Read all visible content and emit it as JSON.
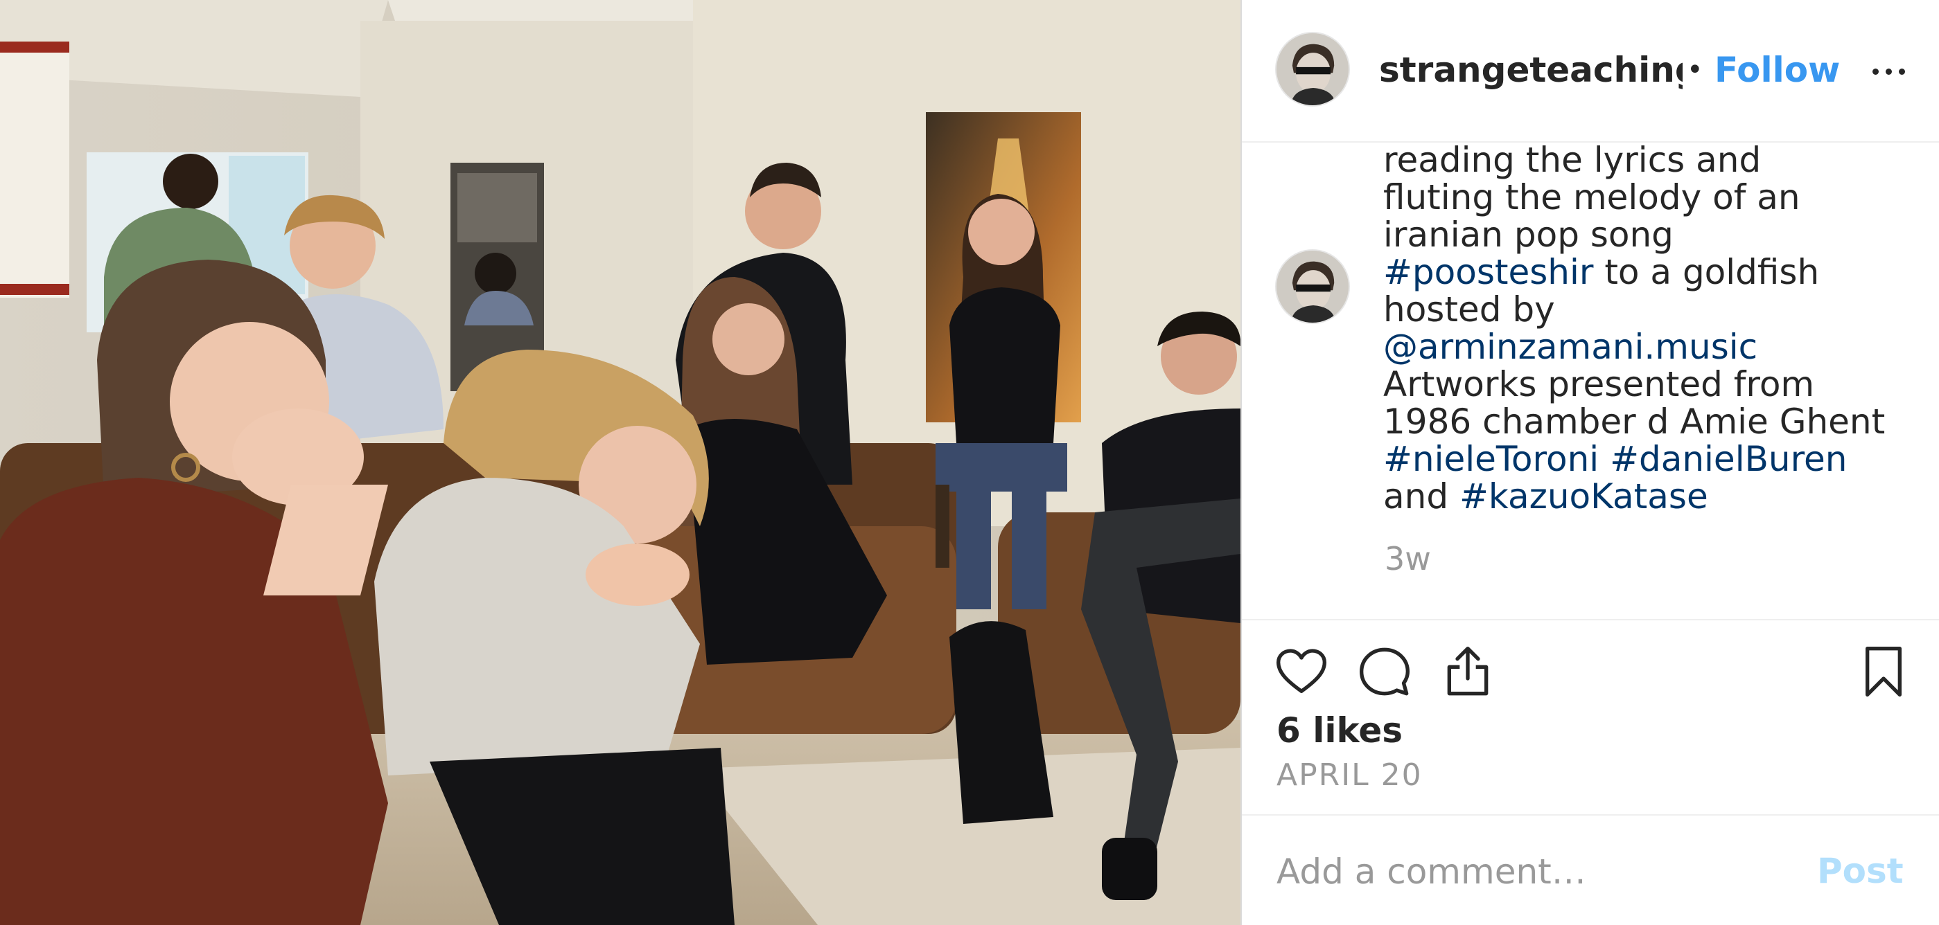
{
  "post": {
    "username": "strangeteaching",
    "separator": "•",
    "follow_label": "Follow",
    "more_icon": "more-horizontal-icon",
    "photo_alt": "Group of people sitting on sofas in a living room listening"
  },
  "caption": {
    "lines": [
      [
        {
          "t": "reading the lyrics and"
        }
      ],
      [
        {
          "t": "fluting the melody of an"
        }
      ],
      [
        {
          "t": "iranian pop song"
        }
      ],
      [
        {
          "t": "#poosteshir",
          "tag": true
        },
        {
          "t": " to a goldfish"
        }
      ],
      [
        {
          "t": "hosted by"
        }
      ],
      [
        {
          "t": "@arminzamani.music",
          "tag": true
        }
      ],
      [
        {
          "t": "Artworks presented from"
        }
      ],
      [
        {
          "t": "1986 chamber d Amie Ghent"
        }
      ],
      [
        {
          "t": "#nieleToroni",
          "tag": true
        },
        {
          "t": " "
        },
        {
          "t": "#danielBuren",
          "tag": true
        }
      ],
      [
        {
          "t": "and "
        },
        {
          "t": "#kazuoKatase",
          "tag": true
        }
      ]
    ],
    "time_ago": "3w"
  },
  "actions": {
    "icons": [
      "heart-icon",
      "comment-icon",
      "share-icon",
      "bookmark-icon"
    ],
    "likes": "6 likes",
    "date": "APRIL 20"
  },
  "comment": {
    "placeholder": "Add a comment…",
    "post_label": "Post"
  },
  "colors": {
    "text": "#262626",
    "link": "#3897f0",
    "hashtag": "#003569",
    "muted": "#999999",
    "post_disabled": "#b2dffc",
    "border": "#efefef"
  }
}
